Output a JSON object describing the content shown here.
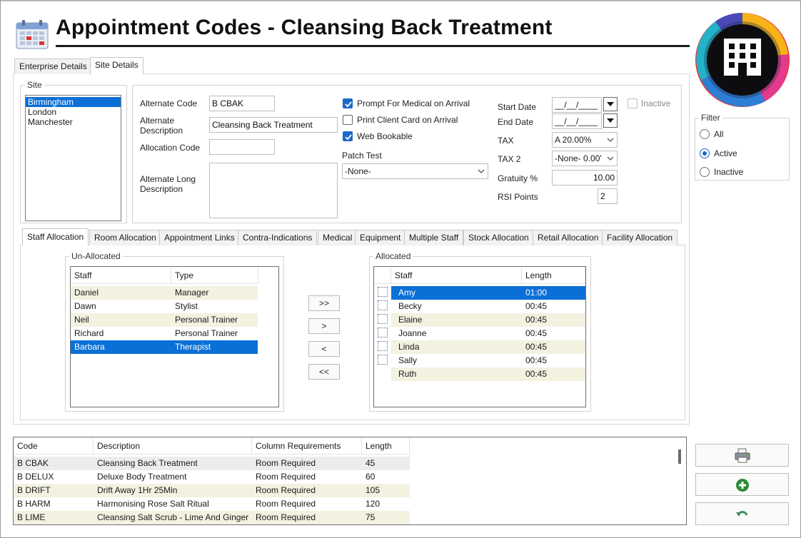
{
  "header": {
    "title": "Appointment Codes - Cleansing Back Treatment",
    "app_icon": "calendar-icon",
    "logo_icon": "building-icon"
  },
  "top_tabs": [
    {
      "label": "Enterprise Details",
      "active": false
    },
    {
      "label": "Site Details",
      "active": true
    }
  ],
  "site": {
    "label": "Site",
    "items": [
      "Birmingham",
      "London",
      "Manchester"
    ],
    "selected_index": 0
  },
  "details": {
    "alternate_code_label": "Alternate Code",
    "alternate_code": "B CBAK",
    "alternate_description_label": "Alternate Description",
    "alternate_description": "Cleansing Back Treatment",
    "allocation_code_label": "Allocation Code",
    "allocation_code": "",
    "alternate_long_description_label": "Alternate Long Description",
    "alternate_long_description": "",
    "prompt_medical_label": "Prompt For Medical on Arrival",
    "prompt_medical": true,
    "print_client_card_label": "Print Client Card on Arrival",
    "print_client_card": false,
    "web_bookable_label": "Web Bookable",
    "web_bookable": true,
    "patch_test_label": "Patch Test",
    "patch_test": "-None-",
    "start_date_label": "Start Date",
    "start_date": "__/__/____",
    "end_date_label": "End Date",
    "end_date": "__/__/____",
    "inactive_label": "Inactive",
    "tax_label": "TAX",
    "tax": "A 20.00%",
    "tax2_label": "TAX 2",
    "tax2": "-None- 0.00'",
    "gratuity_label": "Gratuity %",
    "gratuity": "10.00",
    "rsi_points_label": "RSI Points",
    "rsi_points": "2"
  },
  "filter": {
    "label": "Filter",
    "options": [
      "All",
      "Active",
      "Inactive"
    ],
    "selected": "Active"
  },
  "sub_tabs": [
    {
      "label": "Staff Allocation",
      "active": true
    },
    {
      "label": "Room Allocation",
      "active": false
    },
    {
      "label": "Appointment Links",
      "active": false
    },
    {
      "label": "Contra-Indications",
      "active": false
    },
    {
      "label": "Medical",
      "active": false
    },
    {
      "label": "Equipment",
      "active": false
    },
    {
      "label": "Multiple Staff",
      "active": false
    },
    {
      "label": "Stock Allocation",
      "active": false
    },
    {
      "label": "Retail Allocation",
      "active": false
    },
    {
      "label": "Facility Allocation",
      "active": false
    }
  ],
  "unallocated": {
    "label": "Un-Allocated",
    "columns": [
      "Staff",
      "Type"
    ],
    "rows": [
      [
        "Daniel",
        "Manager"
      ],
      [
        "Dawn",
        "Stylist"
      ],
      [
        "Neil",
        "Personal Trainer"
      ],
      [
        "Richard",
        "Personal Trainer"
      ],
      [
        "Barbara",
        "Therapist"
      ]
    ],
    "selected_index": 4
  },
  "move_buttons": {
    "add_all": ">>",
    "add_one": ">",
    "remove_one": "<",
    "remove_all": "<<"
  },
  "allocated": {
    "label": "Allocated",
    "columns": [
      "Staff",
      "Length"
    ],
    "rows": [
      [
        "Amy",
        "01:00"
      ],
      [
        "Becky",
        "00:45"
      ],
      [
        "Elaine",
        "00:45"
      ],
      [
        "Joanne",
        "00:45"
      ],
      [
        "Linda",
        "00:45"
      ],
      [
        "Sally",
        "00:45"
      ],
      [
        "Ruth",
        "00:45"
      ]
    ],
    "selected_index": 0
  },
  "codes": {
    "columns": [
      "Code",
      "Description",
      "Column Requirements",
      "Length"
    ],
    "rows": [
      [
        "B CBAK",
        "Cleansing Back Treatment",
        "Room Required",
        "45"
      ],
      [
        "B DELUX",
        "Deluxe Body Treatment",
        "Room Required",
        "60"
      ],
      [
        "B DRIFT",
        "Drift Away 1Hr 25Min",
        "Room Required",
        "105"
      ],
      [
        "B HARM",
        "Harmonising Rose Salt Ritual",
        "Room Required",
        "120"
      ],
      [
        "B LIME",
        "Cleansing Salt Scrub - Lime And Ginger",
        "Room Required",
        "75"
      ]
    ]
  },
  "side_buttons": {
    "print_icon": "printer-icon",
    "add_icon": "add-circle-icon",
    "undo_icon": "undo-icon"
  },
  "colors": {
    "selection": "#0a6fd6",
    "checkbox": "#1c69c8",
    "stripe": "#f3f1e0",
    "add_green": "#2e8b3a"
  }
}
